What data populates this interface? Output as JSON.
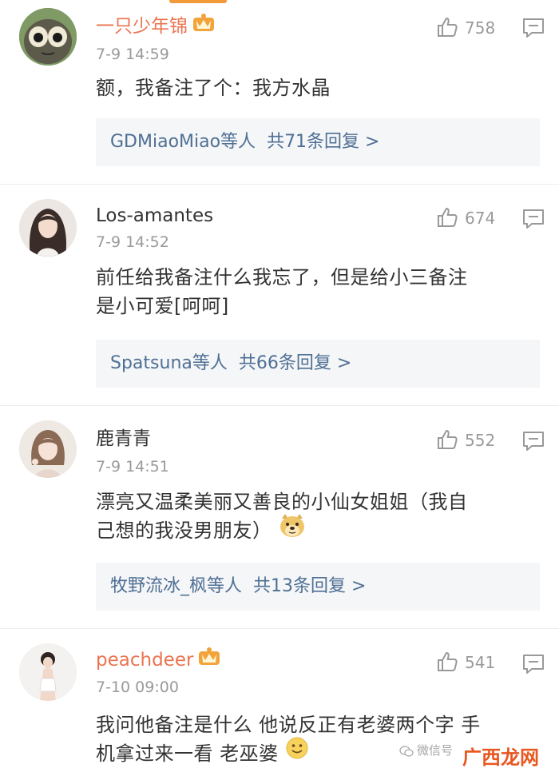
{
  "comments": [
    {
      "username": "一只少年锦",
      "time": "7-9 14:59",
      "text": "额，我备注了个：我方水晶",
      "replies_users": "GDMiaoMiao等人",
      "replies_count": "共71条回复 >",
      "likes": "758"
    },
    {
      "username": "Los-amantes",
      "time": "7-9 14:52",
      "text_line1": "前任给我备注什么我忘了，但是给小三备注",
      "text_line2": "是小可爱[呵呵]",
      "replies_users": "Spatsuna等人",
      "replies_count": "共66条回复 >",
      "likes": "674"
    },
    {
      "username": "鹿青青",
      "time": "7-9 14:51",
      "text_line1": "漂亮又温柔美丽又善良的小仙女姐姐（我自",
      "text_line2": "己想的我没男朋友）",
      "replies_users": "牧野流冰_枫等人",
      "replies_count": "共13条回复 >",
      "likes": "552"
    },
    {
      "username": "peachdeer",
      "time": "7-10 09:00",
      "text_line1": "我问他备注是什么 他说反正有老婆两个字 手",
      "text_line2": "机拿过来一看 老巫婆",
      "likes": "541"
    }
  ],
  "watermark": {
    "text": "微信号",
    "brand": "广西龙网"
  },
  "colors": {
    "vip_name": "#eb7350",
    "reply_link": "#4f6f94",
    "meta_gray": "#9a9a9a"
  },
  "icons": [
    "thumbs-up-icon",
    "comment-reply-icon",
    "vip-crown-icon",
    "doge-emoji-icon",
    "smile-emoji-icon"
  ]
}
